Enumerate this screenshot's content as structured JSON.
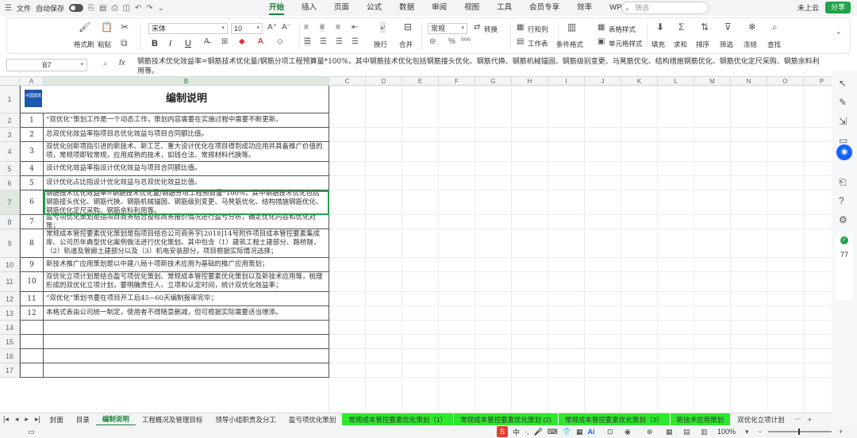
{
  "menubar": {
    "file_label": "文件",
    "autosave_label": "自动保存",
    "tabs": [
      "开始",
      "插入",
      "页面",
      "公式",
      "数据",
      "审阅",
      "视图",
      "工具",
      "会员专享",
      "效率",
      "WPS AI"
    ],
    "active_tab": "开始",
    "search_placeholder": "筛选",
    "cloud_label": "未上云",
    "share_label": "分享"
  },
  "ribbon": {
    "format_painter": "格式刷",
    "paste": "粘贴",
    "font_name": "宋体",
    "font_size": "10",
    "wrap": "换行",
    "merge": "合并",
    "number_format": "常规",
    "convert": "转换",
    "rows_cols": "行和列",
    "worksheet": "工作表",
    "table_style": "表格样式",
    "cond_format": "条件格式",
    "cell_style": "单元格样式",
    "fill": "填充",
    "sum": "求和",
    "sort": "排序",
    "filter": "筛选",
    "freeze": "冻结",
    "find": "查找",
    "bold": "B",
    "italic": "I",
    "underline": "U"
  },
  "formula_bar": {
    "name_box": "B7",
    "fx": "fx",
    "content": "钢筋技术优化效益率=钢筋技术优化量/钢筋分项工程预算量*100%，其中钢筋技术优化包括钢筋接头优化、钢筋代换、钢筋机械锚固、钢筋级别变更、马凳筋优化、结构措施钢筋优化、钢筋优化定尺采购、钢筋余料利用等。"
  },
  "columns": [
    "A",
    "B",
    "C",
    "D",
    "E",
    "F",
    "G",
    "H",
    "I",
    "J",
    "K",
    "L",
    "M",
    "N",
    "O",
    "P"
  ],
  "title": "编制说明",
  "logo_text": "中国建筑",
  "rows": [
    {
      "n": "2",
      "a": "1",
      "b": "“双优化”策划工作是一个动态工作，策划内容需要在实施过程中需要不断更新。"
    },
    {
      "n": "3",
      "a": "2",
      "b": "总双优化效益率指项目总优化效益与项目合同额比值。"
    },
    {
      "n": "4",
      "a": "3",
      "b": "双优化创新项指引进的新技术、新工艺、重大设计优化在项目得到成功应用并具备推广价值的项，常规项即较常规，应用成熟的技术，如钱仓法、常规材料代换等。"
    },
    {
      "n": "5",
      "a": "4",
      "b": "设计优化效益率指设计优化效益与项目合同额比值。"
    },
    {
      "n": "6",
      "a": "5",
      "b": "设计优化占比指设计优化效益与总双优化效益比值。"
    },
    {
      "n": "7",
      "a": "6",
      "b": "钢筋技术优化效益率=钢筋技术优化量/钢筋分项工程预算量*100%，其中钢筋技术优化包括钢筋接头优化、钢筋代换、钢筋机械锚固、钢筋级别变更、马凳筋优化、结构措施钢筋优化、钢筋优化定尺采购、钢筋余料利用等。"
    },
    {
      "n": "8",
      "a": "7",
      "b": "盈亏项优化策划是指项目商务结合投标商务报价情况进行盈亏分析，确定优化内容和优化对策；"
    },
    {
      "n": "9",
      "a": "8",
      "b": "常规成本管控要素优化策划是指项目结合公司商务字[2018]14号附件项目成本管控要素集成库、公司历年典型优化案例做法进行优化策划。其中包含（1）建筑工程土建部分、路桥隧，（2）轨道及管廊土建部分以及（3）机电安装部分，项目根据实际情况选择；"
    },
    {
      "n": "10",
      "a": "9",
      "b": "新技术推广应用策划是以中建八局十项新技术应用为基础的推广应用策划；"
    },
    {
      "n": "11",
      "a": "10",
      "b": "双优化立项计划是结合盈亏项优化策划、常规成本管控要素优化策划以及新技术应用等，梳理形成的双优化立项计划，要明确责任人、立项和认定时间，统计双优化效益率；"
    },
    {
      "n": "12",
      "a": "11",
      "b": "“双优化”策划书要在项目开工后45~60天编制报审完毕；"
    },
    {
      "n": "13",
      "a": "12",
      "b": "本格式表由公司统一制定，使用者不得随意删减，但可根据实际需要适当增添。"
    },
    {
      "n": "14",
      "a": "",
      "b": ""
    },
    {
      "n": "15",
      "a": "",
      "b": ""
    },
    {
      "n": "16",
      "a": "",
      "b": ""
    },
    {
      "n": "17",
      "a": "",
      "b": ""
    }
  ],
  "sheets": {
    "tabs": [
      {
        "label": "封面",
        "style": "normal"
      },
      {
        "label": "目录",
        "style": "normal"
      },
      {
        "label": "编制说明",
        "style": "active"
      },
      {
        "label": "工程概况及管理目标",
        "style": "normal"
      },
      {
        "label": "领导小组职责及分工",
        "style": "normal"
      },
      {
        "label": "盈亏项优化策划",
        "style": "normal"
      },
      {
        "label": "常规成本管控要素优化策划（1）",
        "style": "green"
      },
      {
        "label": "常规成本管控要素优化策划 (2)",
        "style": "green"
      },
      {
        "label": "常规成本管控要素优化策划（3）",
        "style": "green"
      },
      {
        "label": "新技术应用策划",
        "style": "green"
      },
      {
        "label": "双优化立项计划",
        "style": "normal"
      }
    ]
  },
  "status": {
    "zoom": "100%",
    "ime": "中",
    "side_metric": "77"
  },
  "colors": {
    "accent": "#1a7f37",
    "green_tab": "#2ee82e",
    "selection": "#21a34a"
  }
}
